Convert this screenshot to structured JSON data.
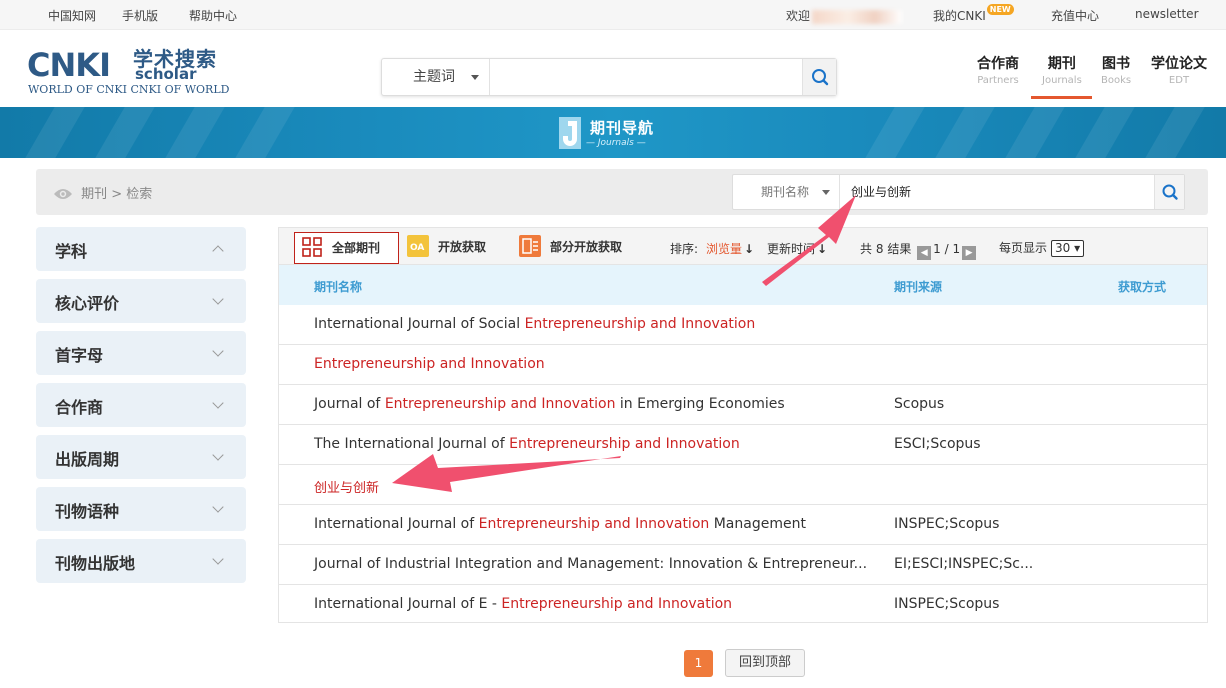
{
  "topbar": {
    "cnki_china": "中国知网",
    "mobile": "手机版",
    "help": "帮助中心",
    "welcome": "欢迎",
    "my_cnki": "我的CNKI",
    "new_badge": "NEW",
    "recharge": "充值中心",
    "newsletter": "newsletter"
  },
  "logo": {
    "main": "CNKI",
    "cn": "学术搜索",
    "scholar": "scholar",
    "sub": "WORLD OF CNKI CNKI OF WORLD"
  },
  "search": {
    "field": "主题词",
    "value": ""
  },
  "nav": [
    {
      "cn": "合作商",
      "en": "Partners"
    },
    {
      "cn": "期刊",
      "en": "Journals"
    },
    {
      "cn": "图书",
      "en": "Books"
    },
    {
      "cn": "学位论文",
      "en": "EDT"
    }
  ],
  "banner": {
    "title": "期刊导航",
    "subtitle": "— Journals —"
  },
  "breadcrumb": {
    "text": "期刊 > 检索"
  },
  "journal_search": {
    "field": "期刊名称",
    "value": "创业与创新"
  },
  "sidebar": {
    "items": [
      {
        "label": "学科",
        "expanded": true
      },
      {
        "label": "核心评价",
        "expanded": false
      },
      {
        "label": "首字母",
        "expanded": false
      },
      {
        "label": "合作商",
        "expanded": false
      },
      {
        "label": "出版周期",
        "expanded": false
      },
      {
        "label": "刊物语种",
        "expanded": false
      },
      {
        "label": "刊物出版地",
        "expanded": false
      }
    ]
  },
  "toolbar": {
    "tabs": [
      "全部期刊",
      "开放获取",
      "部分开放获取"
    ],
    "sort_label": "排序:",
    "sort_by_views": "浏览量",
    "sort_by_update": "更新时间",
    "total_prefix": "共",
    "total": "8",
    "total_suffix": "结果",
    "page_info": "1 / 1",
    "per_page_label": "每页显示",
    "per_page_value": "30"
  },
  "table": {
    "headers": [
      "期刊名称",
      "期刊来源",
      "获取方式"
    ],
    "rows": [
      {
        "pre": "International Journal of Social ",
        "hl": "Entrepreneurship and Innovation",
        "post": "",
        "source": ""
      },
      {
        "pre": "",
        "hl": "Entrepreneurship and Innovation",
        "post": "",
        "source": ""
      },
      {
        "pre": "Journal of ",
        "hl": "Entrepreneurship and Innovation",
        "post": " in Emerging Economies",
        "source": "Scopus"
      },
      {
        "pre": "The International Journal of ",
        "hl": "Entrepreneurship and Innovation",
        "post": "",
        "source": "ESCI;Scopus"
      },
      {
        "pre": "",
        "hl": "创业与创新",
        "post": "",
        "source": ""
      },
      {
        "pre": "International Journal of ",
        "hl": "Entrepreneurship and Innovation",
        "post": " Management",
        "source": "INSPEC;Scopus"
      },
      {
        "pre": "Journal of Industrial Integration and Management: Innovation & Entrepreneur...",
        "hl": "",
        "post": "",
        "source": "EI;ESCI;INSPEC;Sc..."
      },
      {
        "pre": "International Journal of E - ",
        "hl": "Entrepreneurship and Innovation",
        "post": "",
        "source": "INSPEC;Scopus"
      }
    ]
  },
  "pagination": {
    "current": "1",
    "to_top": "回到顶部"
  },
  "colors": {
    "accent_red": "#cc2424",
    "accent_orange": "#ef7a3b",
    "brand_blue": "#2e5a86",
    "header_blue": "#3d9bd1",
    "annotation_pink": "#f0506e"
  }
}
